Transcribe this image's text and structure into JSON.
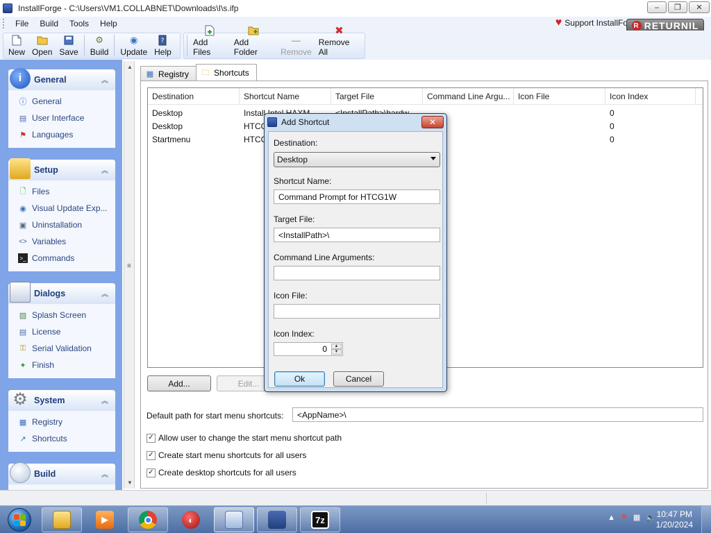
{
  "window": {
    "title": "InstallForge - C:\\Users\\VM1.COLLABNET\\Downloads\\I\\s.ifp",
    "minimize": "–",
    "maximize": "❐",
    "close": "✕"
  },
  "menu": {
    "items": [
      "File",
      "Build",
      "Tools",
      "Help"
    ],
    "support_label": "Support InstallFo",
    "returnil_label": "RETURNIL"
  },
  "toolbar": {
    "new": "New",
    "open": "Open",
    "save": "Save",
    "build": "Build",
    "update": "Update",
    "help": "Help",
    "add_files": "Add Files",
    "add_folder": "Add Folder",
    "remove": "Remove",
    "remove_all": "Remove All"
  },
  "sidebar": {
    "general": {
      "title": "General",
      "items": [
        "General",
        "User Interface",
        "Languages"
      ]
    },
    "setup": {
      "title": "Setup",
      "items": [
        "Files",
        "Visual Update Exp...",
        "Uninstallation",
        "Variables",
        "Commands"
      ]
    },
    "dialogs": {
      "title": "Dialogs",
      "items": [
        "Splash Screen",
        "License",
        "Serial Validation",
        "Finish"
      ]
    },
    "system": {
      "title": "System",
      "items": [
        "Registry",
        "Shortcuts"
      ]
    },
    "build": {
      "title": "Build"
    }
  },
  "tabs": {
    "registry": "Registry",
    "shortcuts": "Shortcuts"
  },
  "shortcuts_list": {
    "columns": [
      "Destination",
      "Shortcut Name",
      "Target File",
      "Command Line Argu...",
      "Icon File",
      "Icon Index"
    ],
    "rows": [
      [
        "Desktop",
        "Install Intel HAXM",
        "<InstallPath>\\hardw",
        "",
        "",
        "0"
      ],
      [
        "Desktop",
        "HTCG",
        "",
        "",
        "",
        "0"
      ],
      [
        "Startmenu",
        "HTCG",
        "",
        "",
        "",
        "0"
      ]
    ]
  },
  "buttons": {
    "add": "Add...",
    "edit": "Edit..."
  },
  "start_menu": {
    "label": "Default path for start menu shortcuts:",
    "value": "<AppName>\\"
  },
  "checks": {
    "allow_change": "Allow user to change the start menu shortcut path",
    "startmenu_all": "Create start menu shortcuts for all users",
    "desktop_all": "Create desktop shortcuts for all users",
    "mark": "✓"
  },
  "dialog": {
    "title": "Add Shortcut",
    "close": "✕",
    "destination_label": "Destination:",
    "destination_value": "Desktop",
    "shortcut_name_label": "Shortcut Name:",
    "shortcut_name_value": "Command Prompt for HTCG1W",
    "target_file_label": "Target File:",
    "target_file_value": "<InstallPath>\\",
    "cmd_args_label": "Command Line Arguments:",
    "cmd_args_value": "",
    "icon_file_label": "Icon File:",
    "icon_file_value": "",
    "icon_index_label": "Icon Index:",
    "icon_index_value": "0",
    "ok": "Ok",
    "cancel": "Cancel"
  },
  "taskbar": {
    "time": "10:47 PM",
    "date": "1/20/2024",
    "seven_zip": "7z"
  }
}
